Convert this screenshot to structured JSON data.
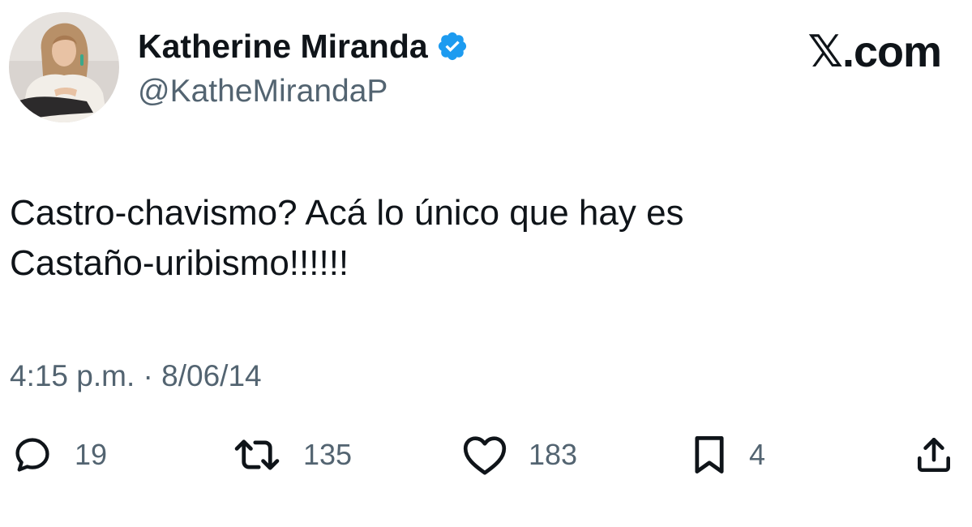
{
  "author": {
    "display_name": "Katherine Miranda",
    "handle": "@KatheMirandaP",
    "avatar_icon": "profile-photo",
    "verified_icon": "verified-badge-icon",
    "verified_color": "#1d9bf0"
  },
  "brand": {
    "label": "𝕏.com"
  },
  "tweet": {
    "text_line1": "Castro-chavismo? Acá lo único que hay es",
    "text_line2": "Castaño-uribismo!!!!!!",
    "time": "4:15 p.m.",
    "separator": " · ",
    "date": "8/06/14"
  },
  "actions": {
    "replies": {
      "icon": "reply-icon",
      "count": "19"
    },
    "reposts": {
      "icon": "repost-icon",
      "count": "135"
    },
    "likes": {
      "icon": "heart-icon",
      "count": "183"
    },
    "bookmarks": {
      "icon": "bookmark-icon",
      "count": "4"
    },
    "share": {
      "icon": "share-icon"
    }
  },
  "colors": {
    "text": "#0f1419",
    "secondary": "#536471",
    "background": "#ffffff"
  }
}
